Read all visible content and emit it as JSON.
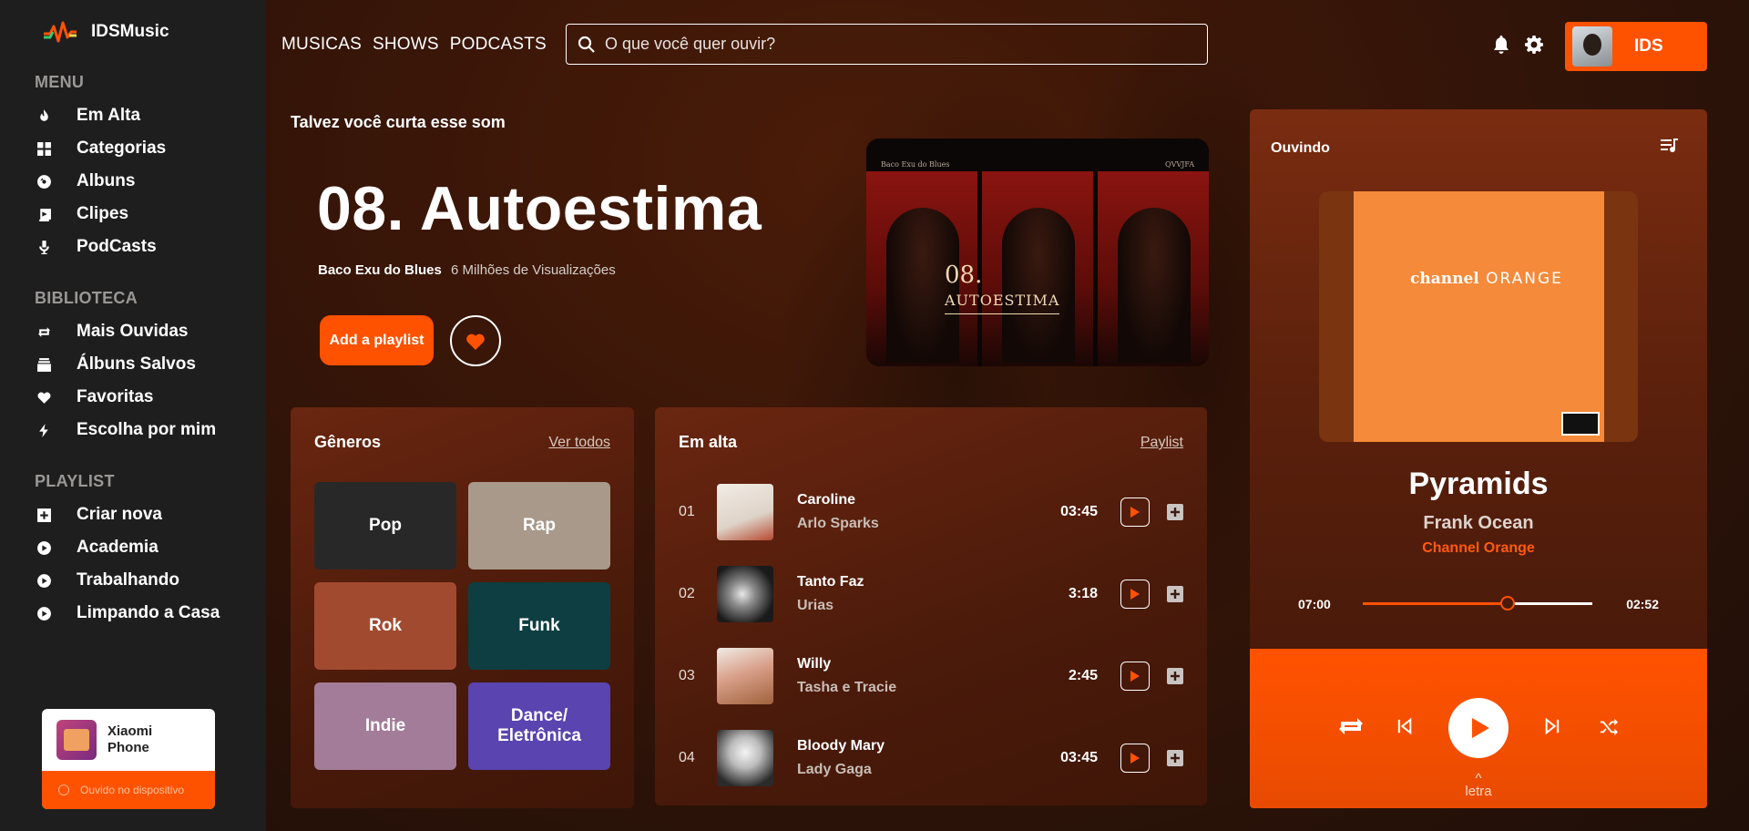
{
  "brand": {
    "name": "IDSMusic"
  },
  "sidebar": {
    "menu_title": "MENU",
    "menu": [
      {
        "label": "Em Alta",
        "icon": "flame-icon"
      },
      {
        "label": "Categorias",
        "icon": "grid-icon"
      },
      {
        "label": "Albuns",
        "icon": "disc-icon"
      },
      {
        "label": "Clipes",
        "icon": "video-icon"
      },
      {
        "label": "PodCasts",
        "icon": "mic-icon"
      }
    ],
    "library_title": "BIBLIOTECA",
    "library": [
      {
        "label": "Mais Ouvidas",
        "icon": "repeat-icon"
      },
      {
        "label": "Álbuns Salvos",
        "icon": "stack-icon"
      },
      {
        "label": "Favoritas",
        "icon": "heart-icon"
      },
      {
        "label": "Escolha por mim",
        "icon": "bolt-icon"
      }
    ],
    "playlist_title": "PLAYLIST",
    "playlists": [
      {
        "label": "Criar nova",
        "icon": "plus-square-icon"
      },
      {
        "label": "Academia",
        "icon": "play-circle-icon"
      },
      {
        "label": "Trabalhando",
        "icon": "play-circle-icon"
      },
      {
        "label": "Limpando a Casa",
        "icon": "play-circle-icon"
      }
    ],
    "device": {
      "name": "Xiaomi Phone",
      "status": "Ouvido no dispositivo"
    }
  },
  "header": {
    "nav": [
      "MUSICAS",
      "SHOWS",
      "PODCASTS"
    ],
    "search_placeholder": "O que você quer ouvir?",
    "user_name": "IDS"
  },
  "hero": {
    "subtitle": "Talvez você curta esse som",
    "title": "08. Autoestima",
    "artist": "Baco Exu do Blues",
    "views": "6 Milhões de Visualizações",
    "add_label": "Add a playlist",
    "art": {
      "top_left": "Baco Exu do Blues",
      "top_right": "QVVJFA",
      "number": "08.",
      "name": "AUTOESTIMA"
    }
  },
  "genres": {
    "title": "Gêneros",
    "link": "Ver todos",
    "items": [
      {
        "label": "Pop",
        "color": "#282828"
      },
      {
        "label": "Rap",
        "color": "#a8998a"
      },
      {
        "label": "Rok",
        "color": "#a24a30"
      },
      {
        "label": "Funk",
        "color": "#0e3e42"
      },
      {
        "label": "Indie",
        "color": "#a27c98"
      },
      {
        "label": "Dance/ Eletrônica",
        "color": "#5944b0"
      }
    ]
  },
  "trending": {
    "title": "Em alta",
    "link": "Paylist",
    "tracks": [
      {
        "num": "01",
        "title": "Caroline",
        "artist": "Arlo Sparks",
        "duration": "03:45"
      },
      {
        "num": "02",
        "title": "Tanto Faz",
        "artist": "Urias",
        "duration": "3:18"
      },
      {
        "num": "03",
        "title": "Willy",
        "artist": "Tasha e Tracie",
        "duration": "2:45"
      },
      {
        "num": "04",
        "title": "Bloody Mary",
        "artist": "Lady Gaga",
        "duration": "03:45"
      }
    ]
  },
  "now_playing": {
    "label": "Ouvindo",
    "song": "Pyramids",
    "artist": "Frank Ocean",
    "album": "Channel Orange",
    "art_text_a": "channel",
    "art_text_b": "ORANGE",
    "elapsed": "07:00",
    "remaining": "02:52",
    "progress": 0.63,
    "lyrics": "letra",
    "lyrics_caret": "^"
  },
  "colors": {
    "accent": "#ff5200",
    "sidebar_bg": "#1f1e1e"
  }
}
